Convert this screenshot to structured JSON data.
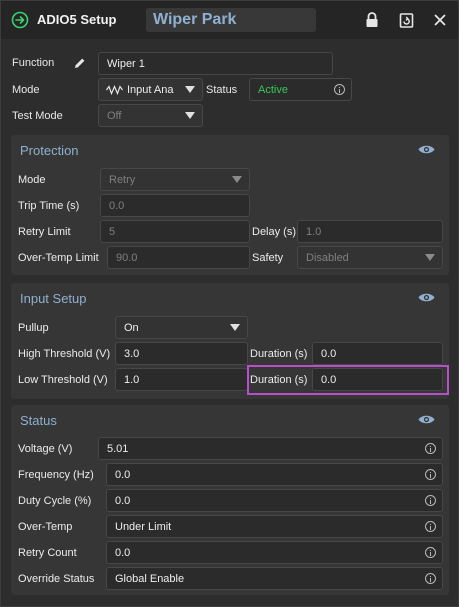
{
  "titlebar": {
    "title": "ADIO5 Setup",
    "name_value": "Wiper Park",
    "icons": [
      "arrow-circle-icon",
      "lock-icon",
      "reset-icon",
      "close-icon"
    ]
  },
  "general": {
    "function_label": "Function",
    "function_value": "Wiper 1",
    "mode_label": "Mode",
    "mode_value": "Input Ana",
    "status_label": "Status",
    "status_value": "Active",
    "status_color": "#34c759",
    "test_mode_label": "Test Mode",
    "test_mode_value": "Off"
  },
  "protection": {
    "title": "Protection",
    "mode_label": "Mode",
    "mode_value": "Retry",
    "trip_time_label": "Trip Time (s)",
    "trip_time_value": "0.0",
    "retry_limit_label": "Retry Limit",
    "retry_limit_value": "5",
    "delay_label": "Delay (s)",
    "delay_value": "1.0",
    "overtemp_label": "Over-Temp Limit",
    "overtemp_value": "90.0",
    "safety_label": "Safety",
    "safety_value": "Disabled"
  },
  "input_setup": {
    "title": "Input Setup",
    "pullup_label": "Pullup",
    "pullup_value": "On",
    "high_threshold_label": "High Threshold (V)",
    "high_threshold_value": "3.0",
    "high_duration_label": "Duration (s)",
    "high_duration_value": "0.0",
    "low_threshold_label": "Low Threshold (V)",
    "low_threshold_value": "1.0",
    "low_duration_label": "Duration (s)",
    "low_duration_value": "0.0"
  },
  "status": {
    "title": "Status",
    "rows": [
      {
        "label": "Voltage (V)",
        "value": "5.01"
      },
      {
        "label": "Frequency (Hz)",
        "value": "0.0"
      },
      {
        "label": "Duty Cycle (%)",
        "value": "0.0"
      },
      {
        "label": "Over-Temp",
        "value": "Under Limit"
      },
      {
        "label": "Retry Count",
        "value": "0.0"
      },
      {
        "label": "Override Status",
        "value": "Global Enable"
      }
    ]
  },
  "colors": {
    "accent": "#8fb0d0",
    "highlight": "#b64fc8",
    "active_green": "#34c759"
  }
}
